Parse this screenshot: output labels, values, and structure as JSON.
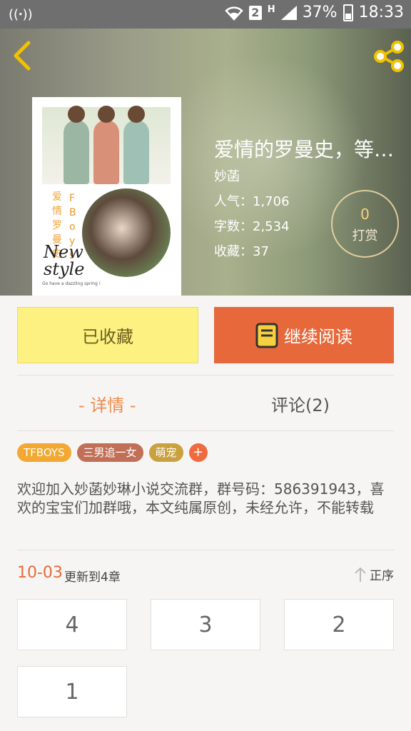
{
  "status_bar": {
    "battery": "37%",
    "time": "18:33",
    "sim_badge": "2",
    "network": "H"
  },
  "book": {
    "title": "爱情的罗曼史，等待…",
    "author": "妙菡",
    "popularity": "人气：1,706",
    "word_count": "字数：2,534",
    "favorites": "收藏：37",
    "tip_count": "0",
    "tip_label": "打赏"
  },
  "cover": {
    "vertical_text_left": "爱情罗曼史",
    "vertical_text_right": "FBoys",
    "style_text_1": "New",
    "style_text_2": "style",
    "small_caption": "Go have a dazzling spring !"
  },
  "actions": {
    "collected_label": "已收藏",
    "continue_label": "继续阅读"
  },
  "tabs": [
    {
      "label": "- 详情 -",
      "active": true
    },
    {
      "label": "评论(2)",
      "active": false
    }
  ],
  "tags": [
    {
      "label": "TFBOYS",
      "color": "#f2a832"
    },
    {
      "label": "三男追一女",
      "color": "#c26f58"
    },
    {
      "label": "萌宠",
      "color": "#c9a13e"
    }
  ],
  "tag_add": "+",
  "description": "欢迎加入妙菡妙琳小说交流群，群号码：586391943，喜欢的宝宝们加群哦，本文纯属原创，未经允许，不能转载",
  "update": {
    "date": "10-03",
    "text": "更新到4章",
    "sort_label": "正序"
  },
  "chapters": [
    "4",
    "3",
    "2",
    "1"
  ],
  "colors": {
    "accent_orange": "#e7683a",
    "collected_yellow": "#fdf281",
    "tab_active": "#ef8c4c"
  }
}
